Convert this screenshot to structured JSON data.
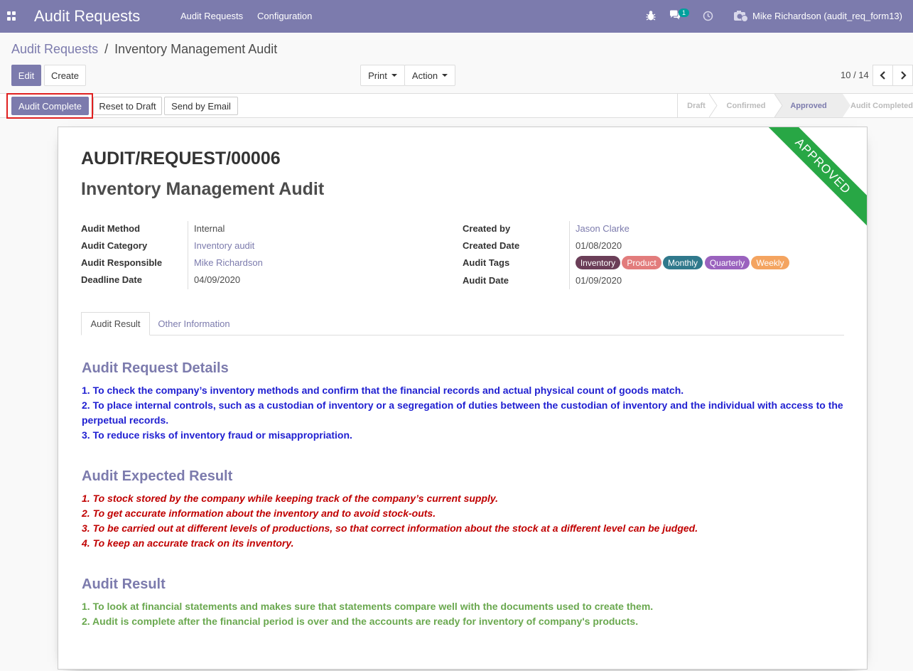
{
  "navbar": {
    "app_title": "Audit Requests",
    "menu": [
      "Audit Requests",
      "Configuration"
    ],
    "chat_count": "1",
    "user": "Mike Richardson (audit_req_form13)",
    "icons": [
      "apps-icon",
      "bug-icon",
      "chat-icon",
      "clock-icon",
      "camera-icon"
    ]
  },
  "breadcrumb": {
    "parent": "Audit Requests",
    "separator": "/",
    "current": "Inventory Management Audit"
  },
  "toolbar": {
    "edit": "Edit",
    "create": "Create",
    "print": "Print",
    "action": "Action"
  },
  "pager": {
    "value": "10 / 14"
  },
  "statusbar": {
    "buttons": [
      "Audit Complete",
      "Reset to Draft",
      "Send by Email"
    ],
    "stages": [
      "Draft",
      "Confirmed",
      "Approved",
      "Audit Completed"
    ],
    "active_stage": "Approved"
  },
  "record": {
    "ribbon": "APPROVED",
    "reference": "AUDIT/REQUEST/00006",
    "name": "Inventory Management Audit",
    "left_fields": [
      {
        "label": "Audit Method",
        "value": "Internal"
      },
      {
        "label": "Audit Category",
        "value": "Inventory audit"
      },
      {
        "label": "Audit Responsible",
        "value": "Mike Richardson"
      },
      {
        "label": "Deadline Date",
        "value": "04/09/2020"
      }
    ],
    "right_fields": [
      {
        "label": "Created by",
        "value": "Jason Clarke"
      },
      {
        "label": "Created Date",
        "value": "01/08/2020"
      },
      {
        "label": "Audit Tags",
        "value": ""
      },
      {
        "label": "Audit Date",
        "value": "01/09/2020"
      }
    ],
    "tags": [
      {
        "name": "Inventory",
        "color": "#6b3e58"
      },
      {
        "name": "Product",
        "color": "#e27c7c"
      },
      {
        "name": "Monthly",
        "color": "#30798c"
      },
      {
        "name": "Quarterly",
        "color": "#9a62be"
      },
      {
        "name": "Weekly",
        "color": "#f4a460"
      }
    ]
  },
  "tabs": [
    "Audit Result",
    "Other Information"
  ],
  "sections": {
    "details": {
      "heading": "Audit Request Details",
      "lines": [
        "1. To check the company’s inventory methods and confirm that the financial records and actual physical count of goods match.",
        "2. To place internal controls, such as a custodian of inventory or a segregation of duties between the custodian of inventory and the individual with access to the perpetual records.",
        "3. To reduce risks of inventory fraud or misappropriation."
      ]
    },
    "expected": {
      "heading": "Audit Expected Result",
      "lines": [
        "1. To stock stored by the company while keeping track of the company’s current supply.",
        "2. To get accurate information about the inventory and to avoid stock-outs.",
        "3. To be carried out at different levels of productions, so that correct information about the stock at a different level can be judged.",
        "4. To keep an accurate track on its inventory."
      ]
    },
    "result": {
      "heading": "Audit Result",
      "lines": [
        "1. To look at financial statements and makes sure that statements compare well with the documents used to create them.",
        "2. Audit is complete after the financial period is over and the accounts are ready for inventory of company's products."
      ]
    }
  }
}
